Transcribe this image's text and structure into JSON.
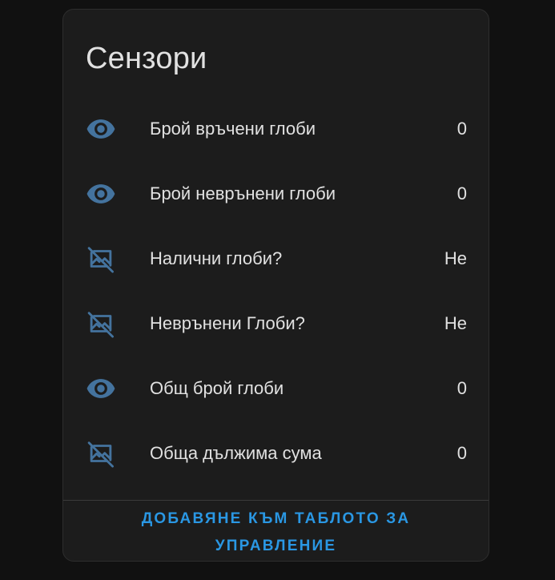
{
  "card": {
    "title": "Сензори",
    "action_label": "ДОБАВЯНЕ КЪМ ТАБЛОТО ЗА УПРАВЛЕНИЕ"
  },
  "colors": {
    "background": "#111111",
    "card": "#1c1c1c",
    "icon": "#44739e",
    "accent": "#2a97e3",
    "text": "#e1e1e1"
  },
  "sensors": [
    {
      "icon": "eye-icon",
      "label": "Брой връчени глоби",
      "value": "0"
    },
    {
      "icon": "eye-icon",
      "label": "Брой неврънени глоби",
      "value": "0"
    },
    {
      "icon": "image-off-icon",
      "label": "Налични глоби?",
      "value": "Не"
    },
    {
      "icon": "image-off-icon",
      "label": "Неврънени Глоби?",
      "value": "Не"
    },
    {
      "icon": "eye-icon",
      "label": "Общ брой глоби",
      "value": "0"
    },
    {
      "icon": "image-off-icon",
      "label": "Обща дължима сума",
      "value": "0"
    }
  ]
}
